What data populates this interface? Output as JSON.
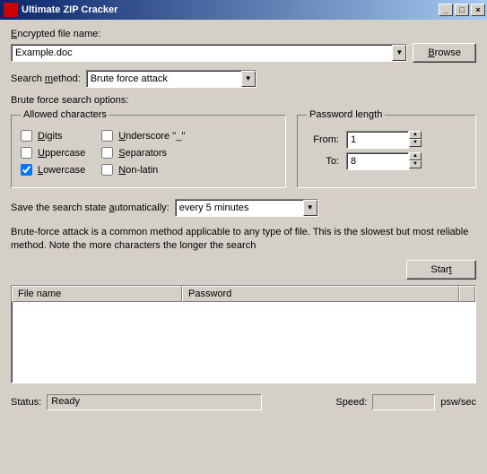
{
  "title": "Ultimate ZIP Cracker",
  "labels": {
    "encrypted": "ncrypted file name:",
    "browse": "rowse",
    "search_method": "Search ",
    "search_method2": "ethod:",
    "bf_options": "Brute force search options:",
    "allowed": "Allowed characters",
    "digits": "igits",
    "uppercase": "ppercase",
    "lowercase": "owercase",
    "underscore": "nderscore ''_''",
    "separators": "eparators",
    "nonlatin": "on-latin",
    "pwdlen": "Password length",
    "from": "From:",
    "to": "To:",
    "save_state": "Save the search state ",
    "save_state2": "utomatically:",
    "start": "Star",
    "start2": "",
    "filename_col": "File name",
    "password_col": "Password",
    "status": "Status:",
    "speed": "Speed:",
    "psw_sec": "psw/sec"
  },
  "values": {
    "file": "Example.doc",
    "method": "Brute force attack",
    "from": "1",
    "to": "8",
    "save_interval": "every 5 minutes",
    "status": "Ready",
    "speed": ""
  },
  "checks": {
    "digits": false,
    "uppercase": false,
    "lowercase": true,
    "underscore": false,
    "separators": false,
    "nonlatin": false
  },
  "description": "Brute-force attack is a common method applicable to any type of file. This is the slowest but most reliable method. Note the more characters the longer the search"
}
